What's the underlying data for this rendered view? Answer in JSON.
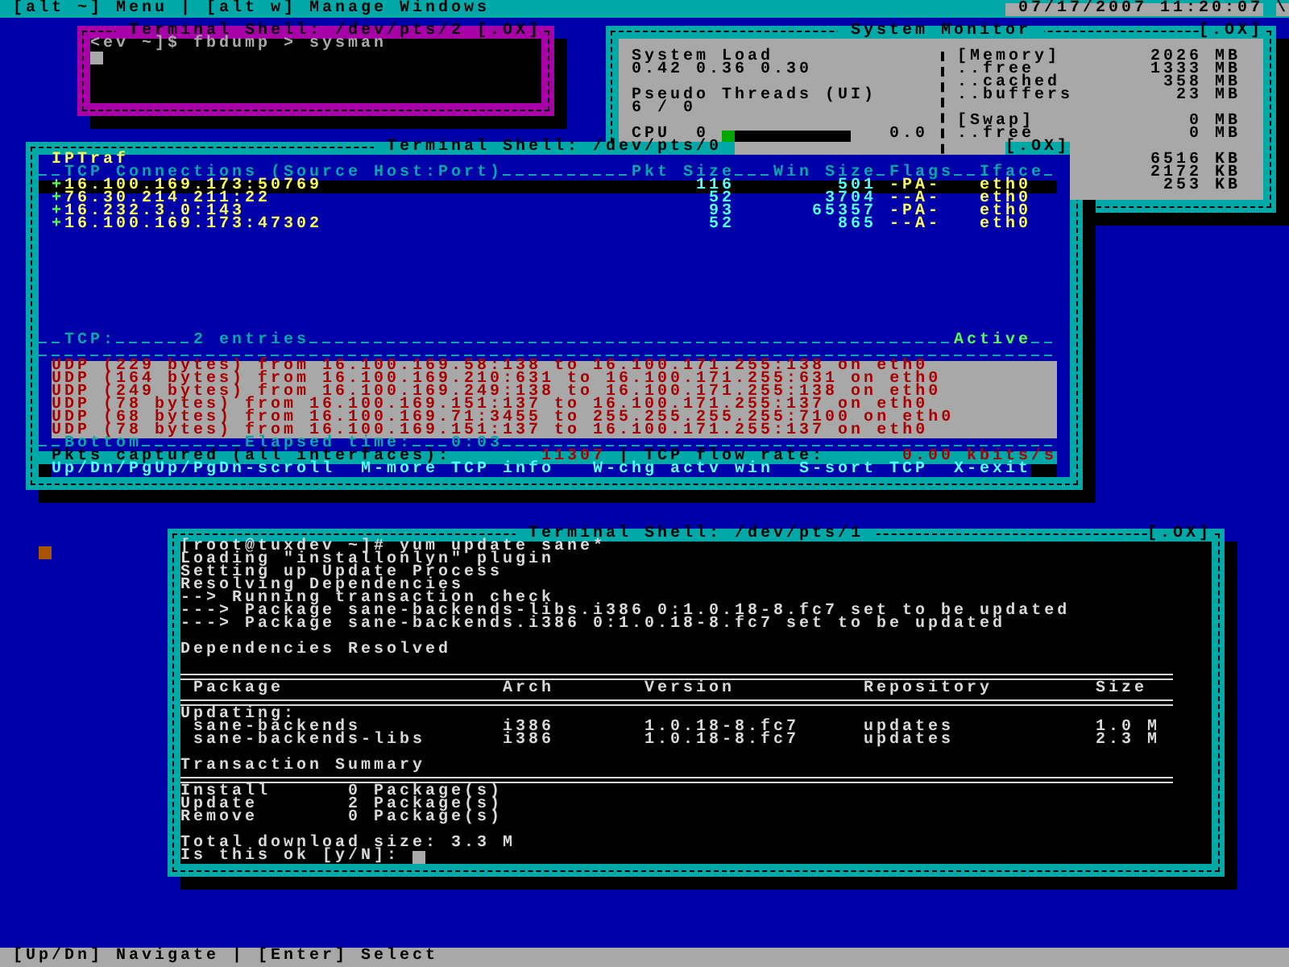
{
  "menu_bar": {
    "items": [
      {
        "label": "[alt ~] Menu"
      },
      {
        "label": "[alt w] Manage Windows"
      }
    ],
    "separator": "|",
    "clock": "07/17/2007 11:20:07",
    "spinner": "\\"
  },
  "windows": [
    {
      "kind": "shell",
      "title": "Terminal Shell: /dev/pts/2",
      "controls": "[.OX]",
      "active": true,
      "lines": [
        {
          "kind": "text",
          "text": "<ev ~]$ fbdump > sysman"
        },
        {
          "kind": "cursor"
        }
      ]
    },
    {
      "kind": "monitor",
      "title": "System Monitor",
      "controls": "[.OX]",
      "active": false,
      "load": {
        "label": "System Load",
        "value": "0.42 0.36 0.30"
      },
      "threads": {
        "label": "Pseudo Threads (UI)",
        "value": "6 / 0"
      },
      "cpu": {
        "label": "CPU",
        "index": "0",
        "level": 0.1,
        "reading": "0.0"
      },
      "memory": [
        {
          "label": "[Memory]",
          "value": "2026",
          "unit": "MB"
        },
        {
          "label": "..free",
          "value": "1333",
          "unit": "MB"
        },
        {
          "label": "..cached",
          "value": "358",
          "unit": "MB"
        },
        {
          "label": "..buffers",
          "value": "23",
          "unit": "MB"
        },
        {
          "label": "[Swap]",
          "value": "0",
          "unit": "MB"
        },
        {
          "label": "..free",
          "value": "0",
          "unit": "MB"
        },
        {
          "value": "6516",
          "unit": "KB"
        },
        {
          "value": "2172",
          "unit": "KB"
        },
        {
          "value": "253",
          "unit": "KB"
        }
      ]
    },
    {
      "kind": "iptraf",
      "title": "Terminal Shell: /dev/pts/0",
      "controls": "[.OX]",
      "active": false,
      "app_title": "IPTraf",
      "header": {
        "title": "TCP Connections (Source Host:Port)",
        "columns": [
          "Pkt Size",
          "Win Size",
          "Flags",
          "Iface"
        ]
      },
      "connections": [
        {
          "marker": "+",
          "host": "16.100.169.173:50769",
          "pkt_size": "116",
          "win_size": "501",
          "flags": "-PA-",
          "iface": "eth0",
          "selected": true
        },
        {
          "marker": "+",
          "host": "76.30.214.211:22",
          "pkt_size": "52",
          "win_size": "3704",
          "flags": "--A-",
          "iface": "eth0",
          "selected": false
        },
        {
          "marker": "+",
          "host": "16.232.3.0:143",
          "pkt_size": "93",
          "win_size": "65357",
          "flags": "-PA-",
          "iface": "eth0",
          "selected": false
        },
        {
          "marker": "+",
          "host": "16.100.169.173:47302",
          "pkt_size": "52",
          "win_size": "865",
          "flags": "--A-",
          "iface": "eth0",
          "selected": false
        }
      ],
      "tcp_summary": {
        "label": "TCP:",
        "count": "2 entries",
        "state": "Active"
      },
      "udp_log": [
        "UDP (229 bytes) from 16.100.169.58:138 to 16.100.171.255:138 on eth0",
        "UDP (164 bytes) from 16.100.169.210:631 to 16.100.171.255:631 on eth0",
        "UDP (249 bytes) from 16.100.169.249:138 to 16.100.171.255:138 on eth0",
        "UDP (78 bytes) from 16.100.169.151:137 to 16.100.171.255:137 on eth0",
        "UDP (68 bytes) from 16.100.169.71:3455 to 255.255.255.255:7100 on eth0",
        "UDP (78 bytes) from 16.100.169.151:137 to 16.100.171.255:137 on eth0"
      ],
      "footer": {
        "position": "Bottom",
        "elapsed_label": "Elapsed time:",
        "elapsed": "0:03"
      },
      "stats": {
        "label": "Pkts captured (all interfaces):",
        "packets": "11307",
        "separator": "|",
        "rate_label": "TCP flow rate:",
        "rate": "0.00",
        "rate_unit": "kbits/s"
      },
      "keys": [
        "Up/Dn/PgUp/PgDn-scroll",
        "M-more TCP info",
        "W-chg actv win",
        "S-sort TCP",
        "X-exit"
      ]
    },
    {
      "kind": "yum",
      "title": "Terminal Shell: /dev/pts/1",
      "controls": "[.OX]",
      "active": false,
      "lines": [
        {
          "kind": "text",
          "text": "[root@tuxdev ~]# yum update sane*"
        },
        {
          "kind": "text",
          "text": "Loading \"installonlyn\" plugin"
        },
        {
          "kind": "text",
          "text": "Setting up Update Process"
        },
        {
          "kind": "text",
          "text": "Resolving Dependencies"
        },
        {
          "kind": "text",
          "text": "--> Running transaction check"
        },
        {
          "kind": "text",
          "text": "---> Package sane-backends-libs.i386 0:1.0.18-8.fc7 set to be updated"
        },
        {
          "kind": "text",
          "text": "---> Package sane-backends.i386 0:1.0.18-8.fc7 set to be updated"
        },
        {
          "kind": "blank"
        },
        {
          "kind": "text",
          "text": "Dependencies Resolved"
        },
        {
          "kind": "blank"
        },
        {
          "kind": "rule"
        },
        {
          "kind": "table_header",
          "cells": [
            "Package",
            "Arch",
            "Version",
            "Repository",
            "Size"
          ]
        },
        {
          "kind": "rule"
        },
        {
          "kind": "text",
          "text": "Updating:"
        },
        {
          "kind": "table_row",
          "cells": [
            "sane-backends",
            "i386",
            "1.0.18-8.fc7",
            "updates",
            "1.0 M"
          ]
        },
        {
          "kind": "table_row",
          "cells": [
            "sane-backends-libs",
            "i386",
            "1.0.18-8.fc7",
            "updates",
            "2.3 M"
          ]
        },
        {
          "kind": "blank"
        },
        {
          "kind": "text",
          "text": "Transaction Summary"
        },
        {
          "kind": "rule"
        },
        {
          "kind": "summary",
          "label": "Install",
          "value": "0 Package(s)"
        },
        {
          "kind": "summary",
          "label": "Update",
          "value": "2 Package(s)"
        },
        {
          "kind": "summary",
          "label": "Remove",
          "value": "0 Package(s)"
        },
        {
          "kind": "blank"
        },
        {
          "kind": "text",
          "text": "Total download size: 3.3 M"
        },
        {
          "kind": "prompt",
          "text": "Is this ok [y/N]:",
          "cursor": true
        }
      ]
    }
  ],
  "status_bar": {
    "items": [
      {
        "label": "[Up/Dn] Navigate"
      },
      {
        "label": "[Enter] Select"
      }
    ],
    "separator": "|"
  }
}
